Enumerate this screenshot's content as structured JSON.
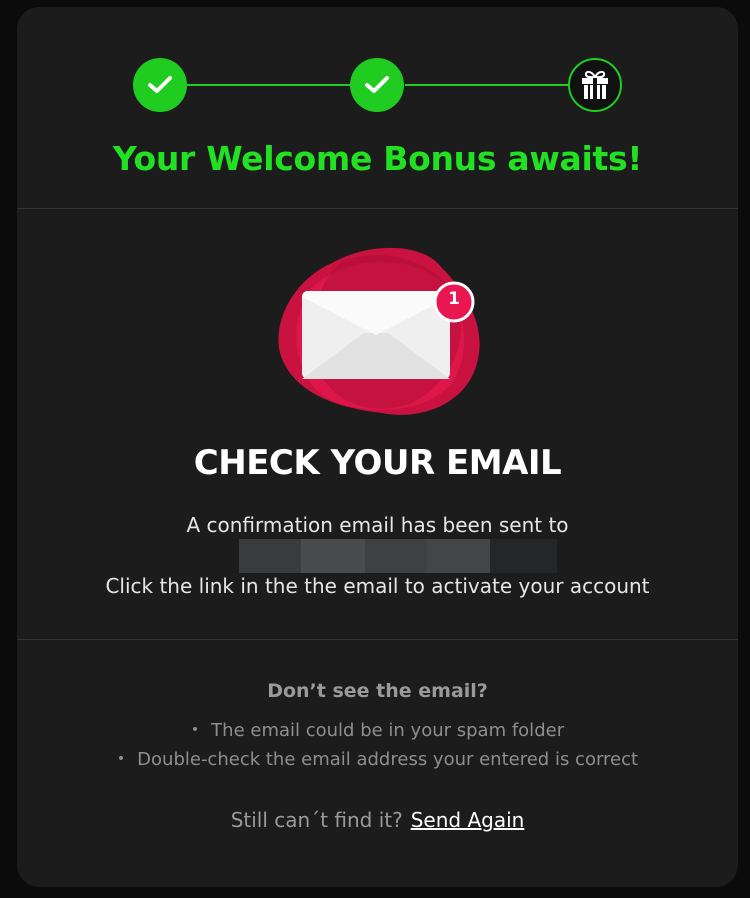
{
  "progress": {
    "steps": [
      {
        "status": "complete",
        "icon": "check-icon"
      },
      {
        "status": "complete",
        "icon": "check-icon"
      },
      {
        "status": "current",
        "icon": "gift-icon"
      }
    ],
    "accent_color": "#1fcc1f"
  },
  "title": "Your Welcome Bonus awaits!",
  "illustration": {
    "icon": "email-envelope-icon",
    "badge_count": "1",
    "badge_color": "#e8174f"
  },
  "heading": "CHECK YOUR EMAIL",
  "sent_text": "A confirmation email has been sent to",
  "instruction": "Click the link in the the email to activate your account",
  "help": {
    "title": "Don’t see the email?",
    "tips": [
      "The email could be in your spam folder",
      "Double-check the email address your entered is correct"
    ]
  },
  "resend": {
    "prompt": "Still can´t find it?",
    "link": "Send Again"
  }
}
